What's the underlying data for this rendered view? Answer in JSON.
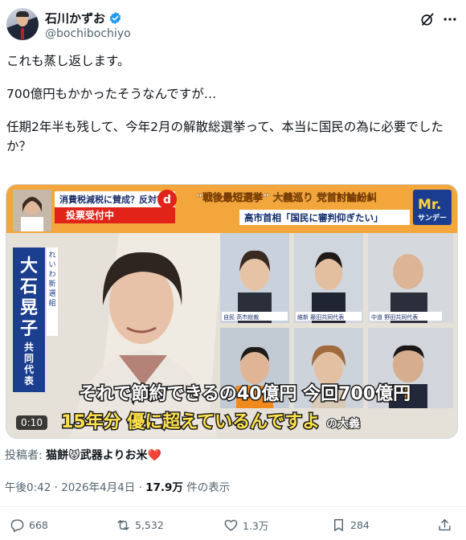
{
  "author": {
    "name": "石川かずお",
    "handle": "@bochibochiyo"
  },
  "post": {
    "paragraphs": [
      "これも蒸し返します。",
      "700億円もかかったそうなんですが…",
      "任期2年半も残して、今年2月の解散総選挙って、本当に国民の為に必要でしたか？"
    ]
  },
  "video": {
    "duration": "0:10",
    "top_banner": "消費税減税に賛成？反対？",
    "vote_label": "投票受付中",
    "headline": "“戦後最短選挙” 大義巡り 党首討論紛糾",
    "subheadline": "高市首相「国民に審判仰ぎたい」",
    "show_logo": "Mr.サンデー",
    "speaker_name": "大石晃子",
    "speaker_party": "れいわ新選組",
    "speaker_role": "共同代表",
    "caption_line1": "それで節約できるの40億円 今回700億円",
    "caption_line2": "15年分 優に超えているんですよ",
    "caption_tail": "の大義",
    "panel_tags": [
      "自民 高市総裁",
      "維新 藤田共同代表",
      "中道 野田共同代表"
    ]
  },
  "poster_line": {
    "prefix": "投稿者: ",
    "name": "猫餅😾武器よりお米❤️"
  },
  "meta": {
    "time": "午後0:42 · 2026年4月4日 · ",
    "views": "17.9万",
    "views_suffix": " 件の表示"
  },
  "actions": {
    "replies": "668",
    "reposts": "5,532",
    "likes": "1.3万",
    "bookmarks": "284"
  },
  "colors": {
    "text": "#0f1419",
    "secondary": "#536471",
    "verified": "#1d9bf0",
    "banner_orange": "#f08a1c",
    "caption_yellow": "#ffe14a"
  }
}
